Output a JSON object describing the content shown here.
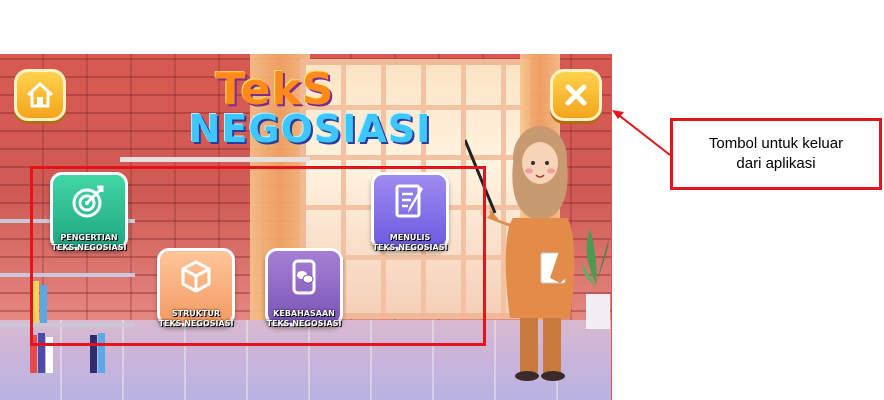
{
  "app": {
    "title_line1": "TekS",
    "title_line2": "NEGOSIASI",
    "home_icon": "home-icon",
    "close_icon": "close-icon"
  },
  "menu": [
    {
      "icon": "target-icon",
      "line1": "PENGERTIAN",
      "line2": "TEKS NEGOSIASI",
      "color": "#2bbf8f"
    },
    {
      "icon": "cube-icon",
      "line1": "STRUKTUR",
      "line2": "TEKS NEGOSIASI",
      "color": "#f5a46e"
    },
    {
      "icon": "phone-chat-icon",
      "line1": "KEBAHASAAN",
      "line2": "TEKS NEGOSIASI",
      "color": "#8a63c4"
    },
    {
      "icon": "writing-icon",
      "line1": "MENULIS",
      "line2": "TEKS NEGOSIASI",
      "color": "#7f6ee8"
    }
  ],
  "annotation": {
    "line1": "Tombol untuk keluar",
    "line2": "dari aplikasi",
    "color": "#e5131b"
  }
}
